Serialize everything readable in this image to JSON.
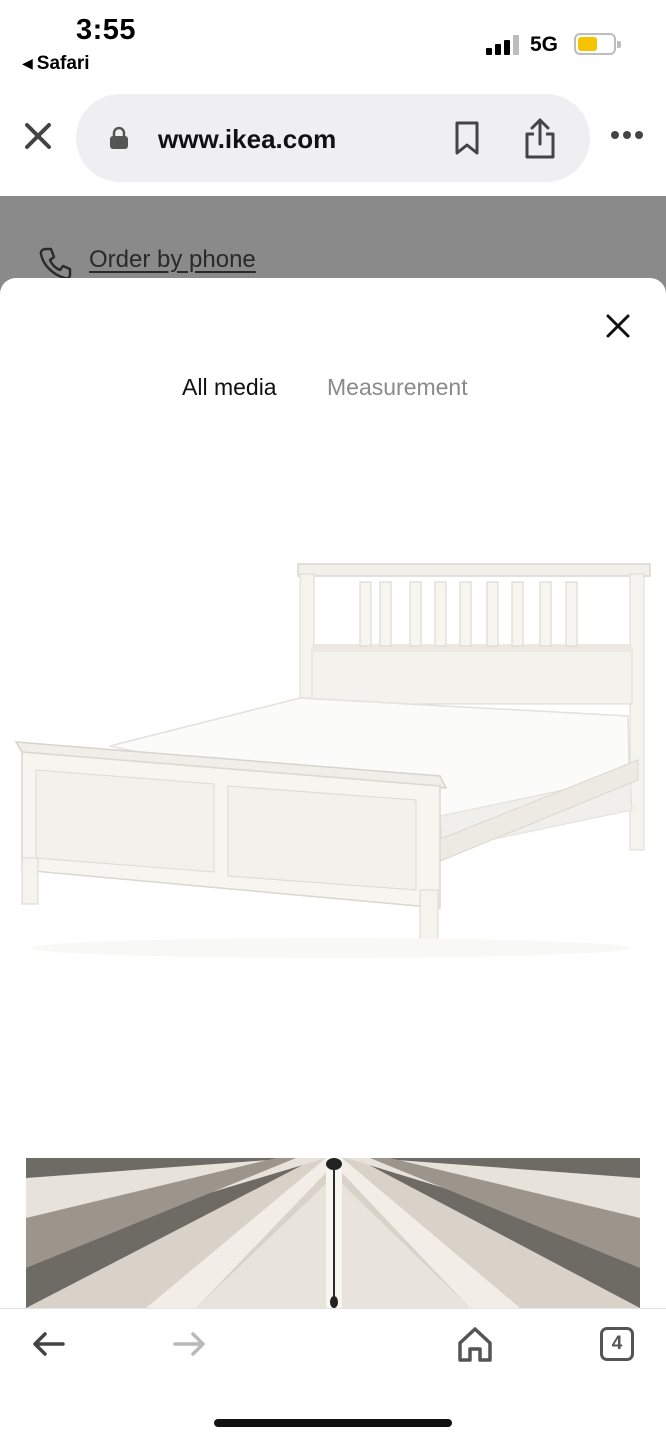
{
  "status_bar": {
    "time": "3:55",
    "back_app_label": "Safari",
    "network": "5G",
    "battery_color": "#f5c400",
    "battery_level": 0.5
  },
  "browser": {
    "url": "www.ikea.com",
    "icons": [
      "close-icon",
      "lock-icon",
      "bookmark-icon",
      "share-icon",
      "more-icon"
    ]
  },
  "page_behind": {
    "order_by_phone_label": "Order by phone"
  },
  "media_sheet": {
    "tabs": [
      {
        "label": "All media",
        "active": true
      },
      {
        "label": "Measurement",
        "active": false
      }
    ],
    "images": [
      {
        "name": "bed-product-image"
      },
      {
        "name": "bedroom-ceiling-image"
      }
    ]
  },
  "toolbar": {
    "tab_count": "4",
    "icons": [
      "back-arrow-icon",
      "forward-arrow-icon",
      "home-icon",
      "tabs-icon"
    ]
  }
}
